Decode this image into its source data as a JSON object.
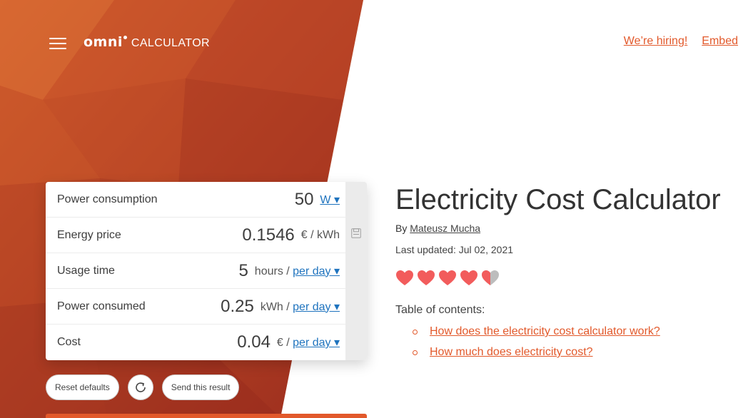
{
  "header": {
    "brand": "omni",
    "brand_sub": "CALCULATOR",
    "hiring_link": "We’re hiring!",
    "embed_link": "Embed"
  },
  "calculator": {
    "rows": [
      {
        "label": "Power consumption",
        "value": "50",
        "unit_static": "",
        "unit_select": "W ▾"
      },
      {
        "label": "Energy price",
        "value": "0.1546",
        "unit_static": "€ / kWh",
        "unit_select": ""
      },
      {
        "label": "Usage time",
        "value": "5",
        "unit_static": "hours / ",
        "unit_select": "per day ▾"
      },
      {
        "label": "Power consumed",
        "value": "0.25",
        "unit_static": "kWh / ",
        "unit_select": "per day ▾"
      },
      {
        "label": "Cost",
        "value": "0.04",
        "unit_static": "€ / ",
        "unit_select": "per day ▾"
      }
    ],
    "buttons": {
      "reset": "Reset defaults",
      "send": "Send this result"
    }
  },
  "article": {
    "title": "Electricity Cost Calculator",
    "by_prefix": "By ",
    "author": "Mateusz Mucha",
    "last_updated": "Last updated: Jul 02, 2021",
    "rating": {
      "value": 4.5,
      "max": 5
    },
    "toc_title": "Table of contents:",
    "toc": [
      "How does the electricity cost calculator work?",
      "How much does electricity cost?"
    ]
  },
  "colors": {
    "accent": "#e2592b",
    "link_blue": "#1e73be",
    "heart": "#f25c5c",
    "heart_empty": "#bdbdbd",
    "panel_dark": "#a8321f",
    "panel_light": "#d4622e"
  },
  "icons": {
    "menu": "hamburger-menu-icon",
    "save": "save-icon",
    "reload": "reload-icon",
    "rating": "heart-icon",
    "toc_bullet": "circle-bullet-icon"
  }
}
